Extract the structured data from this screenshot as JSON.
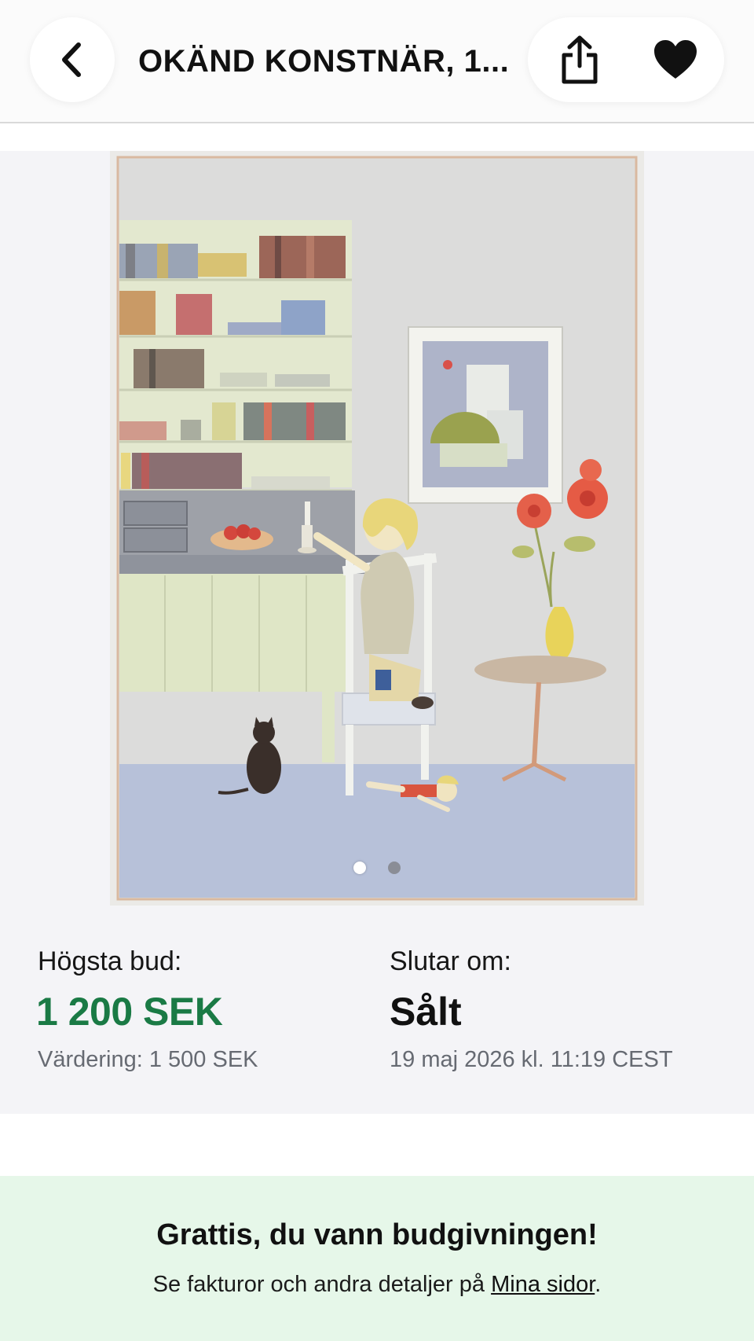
{
  "header": {
    "title": "OKÄND KONSTNÄR, 1...",
    "back_icon": "chevron-left-icon",
    "share_icon": "share-icon",
    "favorite_icon": "heart-icon"
  },
  "gallery": {
    "image_count": 2,
    "active_index": 0
  },
  "bid": {
    "label": "Högsta bud:",
    "value": "1 200 SEK",
    "estimate": "Värdering: 1 500 SEK"
  },
  "ending": {
    "label": "Slutar om:",
    "value": "Sålt",
    "date": "19 maj 2026 kl. 11:19 CEST"
  },
  "win_banner": {
    "title": "Grattis, du vann budgivningen!",
    "text_before": "Se fakturor och andra detaljer på ",
    "link": "Mina sidor",
    "text_after": "."
  },
  "colors": {
    "price_green": "#1a7a45",
    "banner_bg": "#e6f7e9",
    "gallery_bg": "#f4f4f7"
  }
}
